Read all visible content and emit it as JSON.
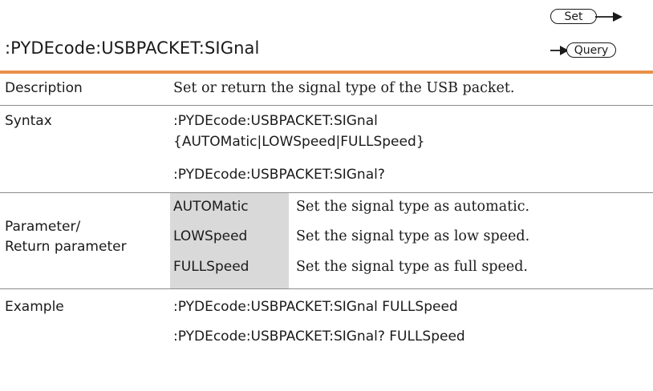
{
  "header": {
    "command": ":PYDEcode:USBPACKET:SIGnal",
    "set_badge": "Set",
    "query_badge": "Query"
  },
  "colors": {
    "accent_rule": "#e8914a",
    "param_shade": "#d9d9d9",
    "divider": "#8c8c8c"
  },
  "description": {
    "label": "Description",
    "text": "Set or return the signal type of the USB packet."
  },
  "syntax": {
    "label": "Syntax",
    "lines": [
      ":PYDEcode:USBPACKET:SIGnal",
      "{AUTOMatic|LOWSpeed|FULLSpeed}",
      ":PYDEcode:USBPACKET:SIGnal?"
    ]
  },
  "parameters": {
    "label_line1": "Parameter/",
    "label_line2": "Return parameter",
    "rows": [
      {
        "name": "AUTOMatic",
        "desc": "Set the signal type as automatic."
      },
      {
        "name": "LOWSpeed",
        "desc": "Set the signal type as low speed."
      },
      {
        "name": "FULLSpeed",
        "desc": "Set the signal type as full speed."
      }
    ]
  },
  "example": {
    "label": "Example",
    "lines": [
      ":PYDEcode:USBPACKET:SIGnal FULLSpeed",
      ":PYDEcode:USBPACKET:SIGnal? FULLSpeed"
    ]
  }
}
